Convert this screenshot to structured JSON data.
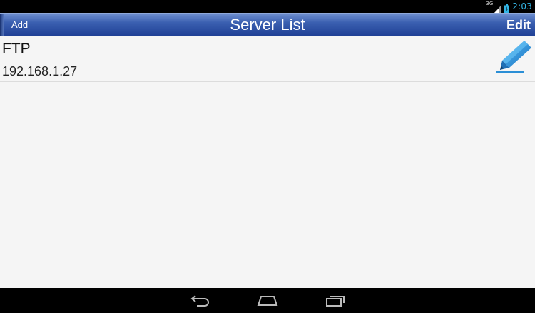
{
  "status_bar": {
    "network": "3G",
    "time": "2:03"
  },
  "header": {
    "add_label": "Add",
    "title": "Server List",
    "edit_label": "Edit"
  },
  "servers": [
    {
      "name": "FTP",
      "address": "192.168.1.27"
    }
  ],
  "icons": {
    "edit": "pencil-icon",
    "signal": "signal-icon",
    "battery": "battery-icon",
    "back": "back-icon",
    "home": "home-icon",
    "recents": "recents-icon"
  },
  "colors": {
    "accent": "#33b5e5",
    "header_top": "#6f8fcf",
    "header_bottom": "#1f3f94",
    "pencil": "#2b8fd6"
  }
}
